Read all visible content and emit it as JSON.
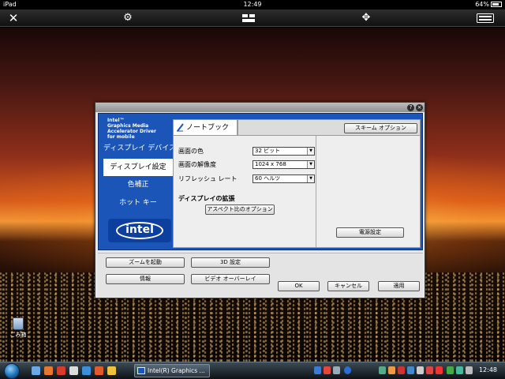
{
  "ipad_status": {
    "device": "iPad",
    "time": "12:49",
    "battery": "64%"
  },
  "toolbar": {
    "close_icon": "✕",
    "settings_icon": "⚙",
    "display_icon": "▬",
    "move_icon": "✥",
    "keyboard_icon": "⌨"
  },
  "dialog": {
    "brand": [
      "Intel™",
      "Graphics Media",
      "Accelerator Driver",
      "for mobile"
    ],
    "nav": [
      "ディスプレイ デバイス",
      "ディスプレイ設定",
      "色補正",
      "ホット キー"
    ],
    "logo": "intel",
    "tab_label": "ノートブック",
    "scheme_button": "スキーム オプション",
    "settings": {
      "color_label": "画面の色",
      "color_value": "32 ビット",
      "resolution_label": "画面の解像度",
      "resolution_value": "1024 x 768",
      "refresh_label": "リフレッシュ レート",
      "refresh_value": "60 ヘルツ"
    },
    "extension_title": "ディスプレイの拡張",
    "aspect_button": "アスペクト比のオプション",
    "power_button": "電源設定",
    "bottom_buttons": {
      "zoom": "ズームを起動",
      "three_d": "3D 設定",
      "info": "情報",
      "video": "ビデオ オーバーレイ",
      "ok": "OK",
      "cancel": "キャンセル",
      "apply": "適用"
    },
    "help_icon": "?",
    "close_icon": "×"
  },
  "desktop": {
    "trash_label": "ごみ箱"
  },
  "taskbar": {
    "task_label": "Intel(R) Graphics ...",
    "clock": "12:48"
  }
}
